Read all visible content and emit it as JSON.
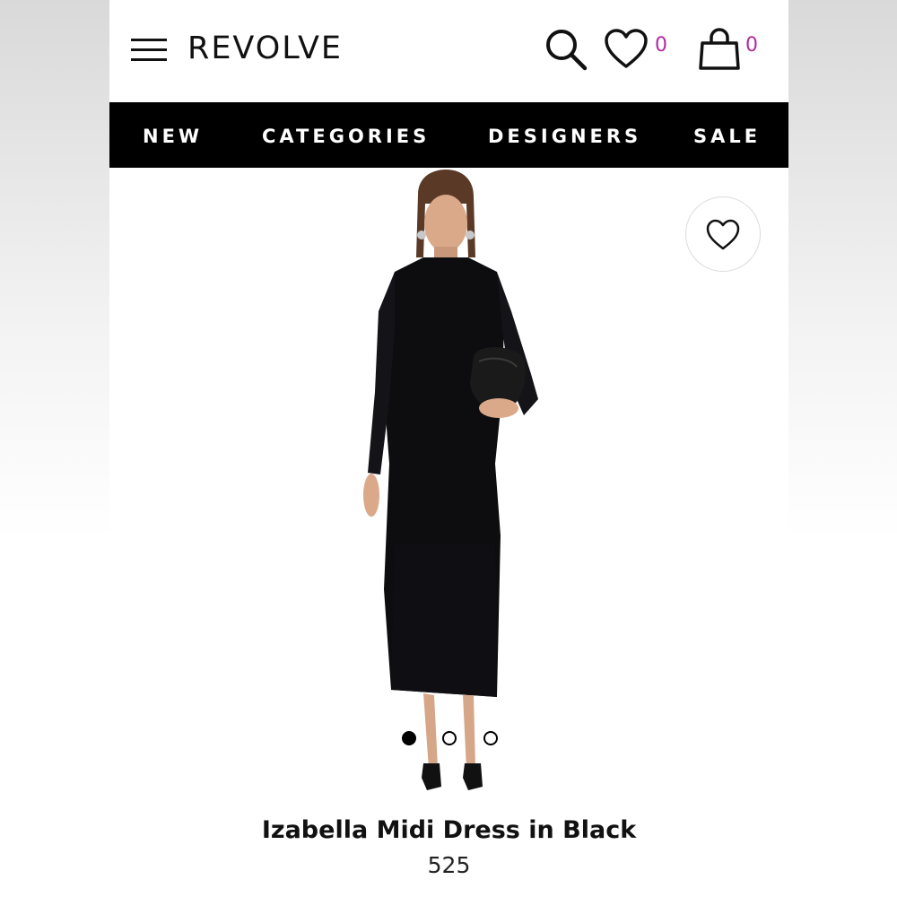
{
  "header": {
    "logo": "REVOLVE",
    "wishlist_count": "0",
    "bag_count": "0"
  },
  "nav": {
    "items": [
      "NEW",
      "CATEGORIES",
      "DESIGNERS",
      "SALE"
    ]
  },
  "product": {
    "name": "Izabella Midi Dress in Black",
    "price": "525",
    "image_count": 3,
    "active_image": 1
  },
  "icons": {
    "menu": "hamburger-menu-icon",
    "search": "search-icon",
    "wishlist": "heart-icon",
    "bag": "shopping-bag-icon"
  },
  "colors": {
    "accent": "#b12aa4",
    "nav_bg": "#000000",
    "text": "#111111"
  }
}
